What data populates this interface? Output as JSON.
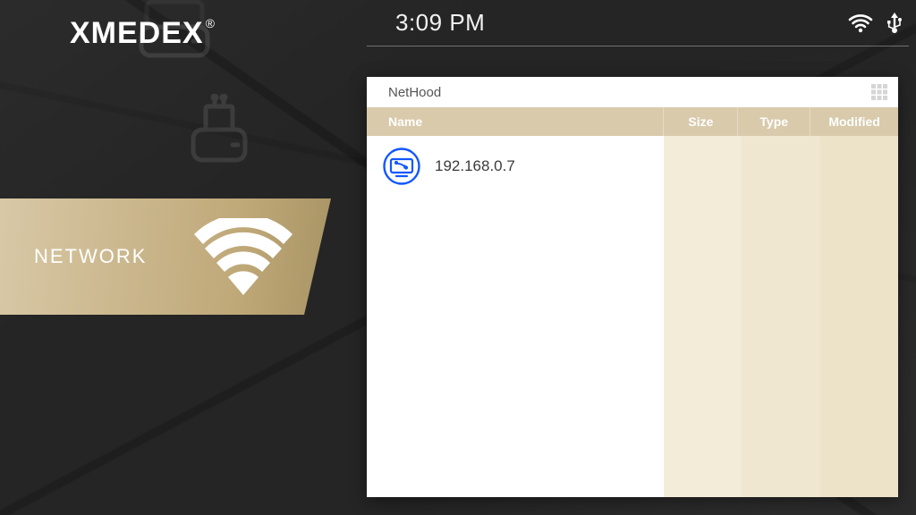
{
  "brand": {
    "name": "XMEDEX",
    "reg": "®"
  },
  "statusbar": {
    "time": "3:09 PM"
  },
  "sidebar": {
    "network": {
      "label": "NETWORK"
    }
  },
  "panel": {
    "breadcrumb": "NetHood",
    "columns": {
      "name": "Name",
      "size": "Size",
      "type": "Type",
      "modified": "Modified"
    },
    "rows": [
      {
        "name": "192.168.0.7"
      }
    ]
  }
}
